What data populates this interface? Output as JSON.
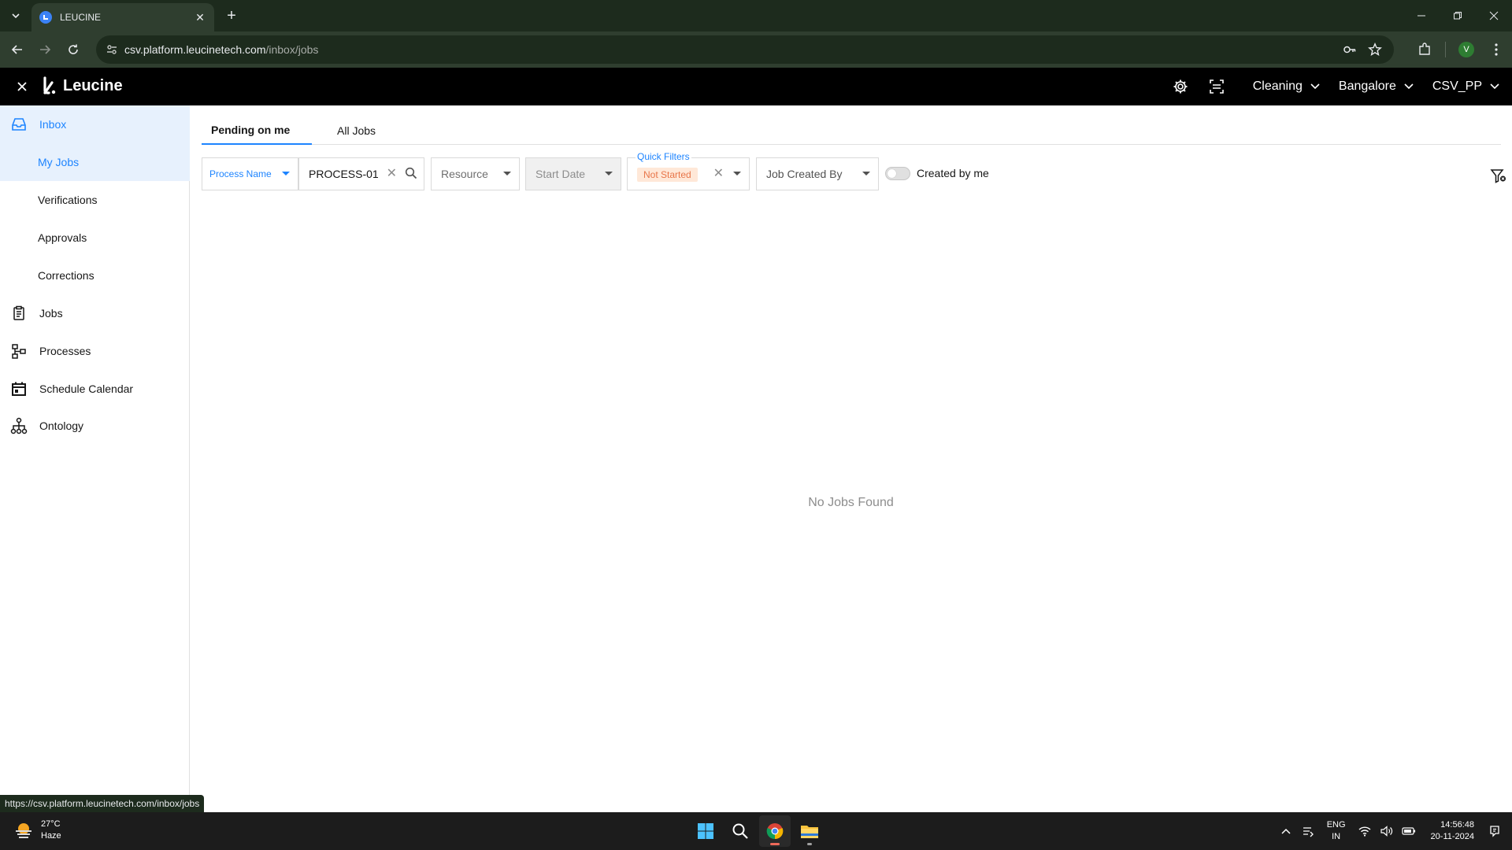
{
  "browser": {
    "tab_title": "LEUCINE",
    "url_host": "csv.platform.leucinetech.com",
    "url_path": "/inbox/jobs",
    "profile_initial": "V",
    "status_url": "https://csv.platform.leucinetech.com/inbox/jobs"
  },
  "header": {
    "brand": "Leucine",
    "use_case": "Cleaning",
    "facility": "Bangalore",
    "user": "CSV_PP"
  },
  "sidebar": {
    "items": [
      {
        "label": "Inbox",
        "icon": "inbox-icon"
      },
      {
        "label": "My Jobs"
      },
      {
        "label": "Verifications"
      },
      {
        "label": "Approvals"
      },
      {
        "label": "Corrections"
      },
      {
        "label": "Jobs",
        "icon": "clipboard-icon"
      },
      {
        "label": "Processes",
        "icon": "flow-icon"
      },
      {
        "label": "Schedule Calendar",
        "icon": "calendar-icon"
      },
      {
        "label": "Ontology",
        "icon": "hierarchy-icon"
      }
    ]
  },
  "tabs": [
    "Pending on me",
    "All Jobs"
  ],
  "filters": {
    "process_name_label": "Process Name",
    "search_value": "PROCESS-01",
    "resource_placeholder": "Resource",
    "start_date_placeholder": "Start Date",
    "quick_filters_label": "Quick Filters",
    "quick_filter_chip": "Not Started",
    "job_created_by_placeholder": "Job Created By",
    "created_by_me_label": "Created by me"
  },
  "empty_state": "No Jobs Found",
  "taskbar": {
    "temperature": "27°C",
    "weather": "Haze",
    "lang_top": "ENG",
    "lang_bottom": "IN",
    "time": "14:56:48",
    "date": "20-11-2024"
  },
  "colors": {
    "accent": "#1d84ff",
    "active_bg": "#e7f1fd",
    "chip_bg": "#ffe8d8",
    "chip_text": "#e8764a",
    "header_bg": "#000000"
  }
}
